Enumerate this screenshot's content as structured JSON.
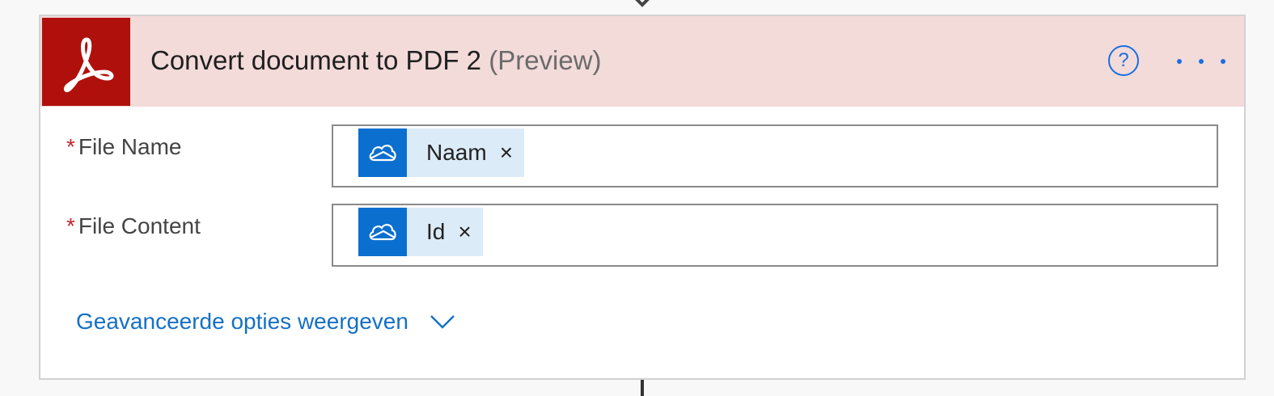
{
  "card": {
    "title": "Convert document to PDF 2",
    "title_suffix": "(Preview)",
    "header_color": "#f3dbda",
    "icon_color": "#b0100c",
    "app_icon": "adobe-acrobat-icon",
    "help_icon": "question-circle-icon",
    "more_icon": "ellipsis-icon"
  },
  "fields": [
    {
      "label": "File Name",
      "required_mark": "*",
      "token": {
        "label": "Naam",
        "remove": "×",
        "icon": "onedrive-cloud-icon"
      }
    },
    {
      "label": "File Content",
      "required_mark": "*",
      "token": {
        "label": "Id",
        "remove": "×",
        "icon": "onedrive-cloud-icon"
      }
    }
  ],
  "advanced_link": {
    "label": "Geavanceerde opties weergeven",
    "icon": "chevron-down-icon"
  }
}
